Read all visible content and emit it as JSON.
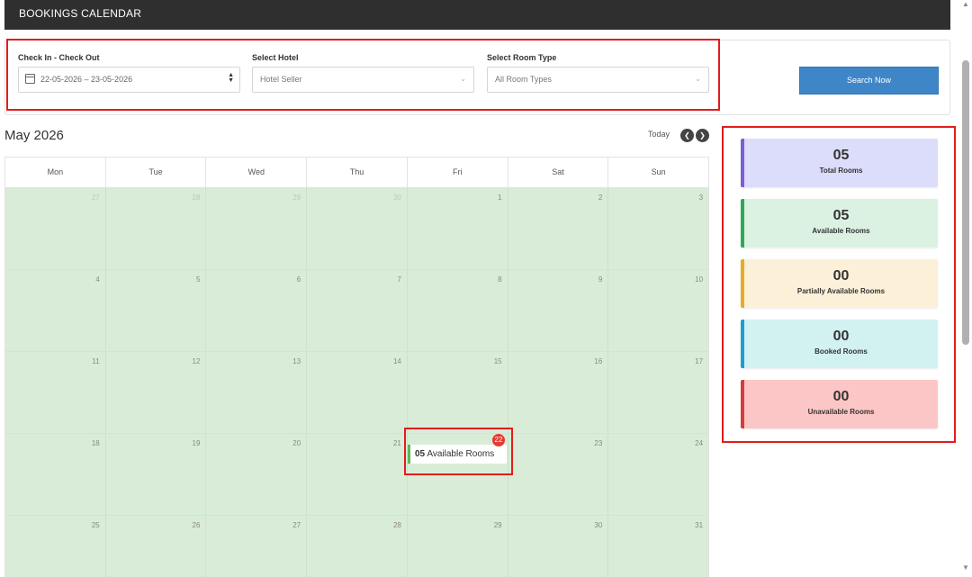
{
  "header": {
    "title": "BOOKINGS CALENDAR"
  },
  "filters": {
    "checkin_label": "Check In - Check Out",
    "checkin_value": "22-05-2026 – 23-05-2026",
    "hotel_label": "Select Hotel",
    "hotel_value": "Hotel Seller",
    "room_type_label": "Select Room Type",
    "room_type_value": "All Room Types",
    "search_button": "Search Now"
  },
  "calendar": {
    "month": "May 2026",
    "today_label": "Today",
    "weekdays": [
      "Mon",
      "Tue",
      "Wed",
      "Thu",
      "Fri",
      "Sat",
      "Sun"
    ],
    "weeks": [
      [
        "27",
        "28",
        "29",
        "30",
        "1",
        "2",
        "3"
      ],
      [
        "4",
        "5",
        "6",
        "7",
        "8",
        "9",
        "10"
      ],
      [
        "11",
        "12",
        "13",
        "14",
        "15",
        "16",
        "17"
      ],
      [
        "18",
        "19",
        "20",
        "21",
        "22",
        "23",
        "24"
      ],
      [
        "25",
        "26",
        "27",
        "28",
        "29",
        "30",
        "31"
      ]
    ],
    "event": {
      "count": "05",
      "text": "Available Rooms",
      "badge": "22"
    }
  },
  "stats": [
    {
      "value": "05",
      "label": "Total Rooms",
      "bg": "#dcdcfb",
      "accent": "#7b5fd6"
    },
    {
      "value": "05",
      "label": "Available Rooms",
      "bg": "#dbf1e2",
      "accent": "#2eaa55"
    },
    {
      "value": "00",
      "label": "Partially Available Rooms",
      "bg": "#fdf0d8",
      "accent": "#e5ad22"
    },
    {
      "value": "00",
      "label": "Booked Rooms",
      "bg": "#d2f1f1",
      "accent": "#1a9fcf"
    },
    {
      "value": "00",
      "label": "Unavailable Rooms",
      "bg": "#fdc6c6",
      "accent": "#d93a3a"
    }
  ]
}
